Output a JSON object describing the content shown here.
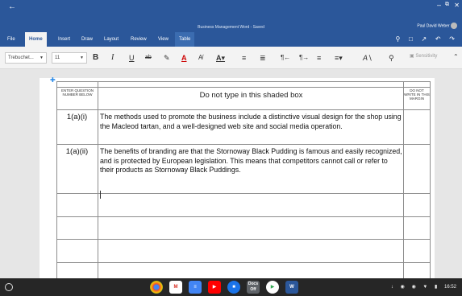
{
  "window": {
    "title": "Business Management Word - Saved",
    "user_name": "Paul David Weber"
  },
  "ribbon": {
    "tabs": [
      "File",
      "Home",
      "Insert",
      "Draw",
      "Layout",
      "Review",
      "View",
      "Table"
    ],
    "active_tab": "Home"
  },
  "toolbar": {
    "font_name": "Trebuchet...",
    "font_size": "11",
    "sensitivity_label": "Sensitivity"
  },
  "document": {
    "header_left": "ENTER QUESTION NUMBER BELOW",
    "header_center": "Do not type in this shaded box",
    "header_right": "DO NOT WRITE IN THIS MARGIN",
    "rows": [
      {
        "number": "1(a)(i)",
        "text": "The methods used to promote the business include a distinctive visual design for the shop using the Macleod tartan, and a well-designed web site and social media operation."
      },
      {
        "number": "1(a)(ii)",
        "text": "The benefits of branding are that the Stornoway Black Pudding is famous and easily recognized, and is protected by European legislation. This means that competitors cannot call or refer to their products as Stornoway Black Puddings."
      }
    ]
  },
  "shelf": {
    "apps": [
      "chrome-icon",
      "gmail-icon",
      "docs-icon",
      "youtube-icon",
      "files-icon",
      "docs-offline-icon",
      "play-store-icon",
      "word-icon"
    ],
    "clock": "16:52"
  }
}
